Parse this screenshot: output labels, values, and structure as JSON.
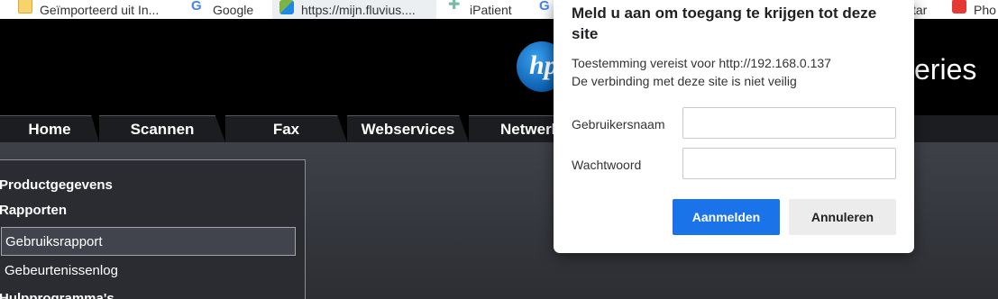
{
  "bookmarks": {
    "items": [
      {
        "label": "Geïmporteerd uit In...",
        "icon": "folder-icon"
      },
      {
        "label": "Google",
        "icon": "google-icon"
      },
      {
        "label": "https://mijn.fluvius....",
        "icon": "fluvius-icon"
      },
      {
        "label": "iPatient",
        "icon": "ipatient-icon"
      },
      {
        "label": "",
        "icon": "google-icon"
      },
      {
        "label": "tar",
        "icon": ""
      },
      {
        "label": "Pho",
        "icon": "photo-icon"
      }
    ]
  },
  "header": {
    "logo_text": "hp",
    "series_text": "eries"
  },
  "nav": {
    "tabs": [
      {
        "label": "Home"
      },
      {
        "label": "Scannen"
      },
      {
        "label": "Fax"
      },
      {
        "label": "Webservices"
      },
      {
        "label": "Netwerk"
      }
    ]
  },
  "sidebar": {
    "heading1": "Productgegevens",
    "heading2": "Rapporten",
    "items": [
      {
        "label": "Gebruiksrapport",
        "active": true
      },
      {
        "label": "Gebeurtenissenlog",
        "active": false
      }
    ],
    "heading3": "Hulpprogramma's"
  },
  "dialog": {
    "title": "Meld u aan om toegang te krijgen tot deze site",
    "line1": "Toestemming vereist voor http://192.168.0.137",
    "line2": "De verbinding met deze site is niet veilig",
    "username_label": "Gebruikersnaam",
    "username_value": "",
    "password_label": "Wachtwoord",
    "password_value": "",
    "signin_label": "Aanmelden",
    "cancel_label": "Annuleren"
  },
  "colors": {
    "accent": "#1a73e8",
    "nav_bg": "#1b1d21",
    "content_bg": "#3e4148"
  }
}
